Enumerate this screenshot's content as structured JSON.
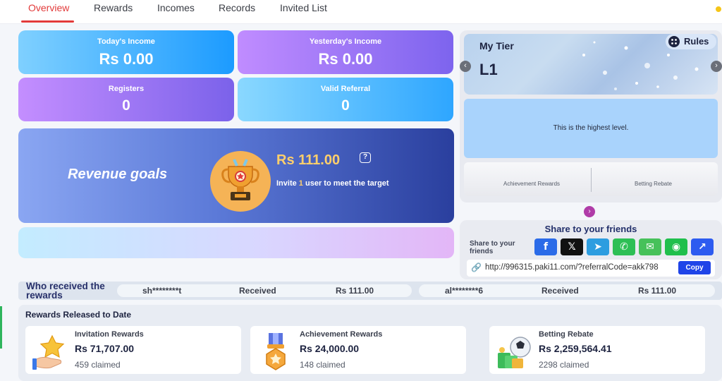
{
  "tabs": [
    {
      "label": "Overview",
      "active": true
    },
    {
      "label": "Rewards"
    },
    {
      "label": "Incomes"
    },
    {
      "label": "Records"
    },
    {
      "label": "Invited List"
    }
  ],
  "stats": {
    "todays_income": {
      "label": "Today's Income",
      "value": "Rs  0.00"
    },
    "yesterdays_income": {
      "label": "Yesterday's Income",
      "value": "Rs  0.00"
    },
    "registers": {
      "label": "Registers",
      "value": "0"
    },
    "valid_referral": {
      "label": "Valid Referral",
      "value": "0"
    }
  },
  "revenue": {
    "title": "Revenue goals",
    "amount": "Rs  111.00",
    "help_icon": "question-icon",
    "invite_prefix": "Invite",
    "invite_count": "1",
    "invite_suffix": "user to meet the target"
  },
  "tier": {
    "title": "My Tier",
    "level": "L1",
    "rules_label": "Rules",
    "message": "This is the highest level.",
    "tabs": [
      "Achievement Rewards",
      "Betting Rebate"
    ],
    "prev_arrow": "‹",
    "next_arrow": "›"
  },
  "share": {
    "title": "Share to your friends",
    "label": "Share to your friends",
    "networks": [
      {
        "name": "facebook-icon",
        "glyph": "f",
        "color": "#2b6be8"
      },
      {
        "name": "x-icon",
        "glyph": "𝕏",
        "color": "#111111"
      },
      {
        "name": "telegram-icon",
        "glyph": "➤",
        "color": "#2d9de0"
      },
      {
        "name": "whatsapp-icon",
        "glyph": "✆",
        "color": "#2dbf55"
      },
      {
        "name": "sms-icon",
        "glyph": "✉",
        "color": "#46c15a"
      },
      {
        "name": "line-icon",
        "glyph": "◉",
        "color": "#1fbf4c"
      },
      {
        "name": "share-icon",
        "glyph": "↗",
        "color": "#2d5bf0"
      }
    ],
    "link": "http://996315.paki11.com/?referralCode=akk798",
    "copy_label": "Copy"
  },
  "ticker": {
    "title": "Who received the rewards",
    "entries": [
      {
        "user": "sh********t",
        "status": "Received",
        "amount": "Rs  111.00"
      },
      {
        "user": "al********6",
        "status": "Received",
        "amount": "Rs  111.00"
      }
    ]
  },
  "released": {
    "title": "Rewards Released to Date",
    "cards": [
      {
        "name": "Invitation Rewards",
        "amount": "Rs  71,707.00",
        "claimed": "459 claimed",
        "icon": "star-hand-icon"
      },
      {
        "name": "Achievement Rewards",
        "amount": "Rs  24,000.00",
        "claimed": "148 claimed",
        "icon": "medal-icon"
      },
      {
        "name": "Betting Rebate",
        "amount": "Rs  2,259,564.41",
        "claimed": "2298 claimed",
        "icon": "money-ball-icon"
      }
    ]
  }
}
